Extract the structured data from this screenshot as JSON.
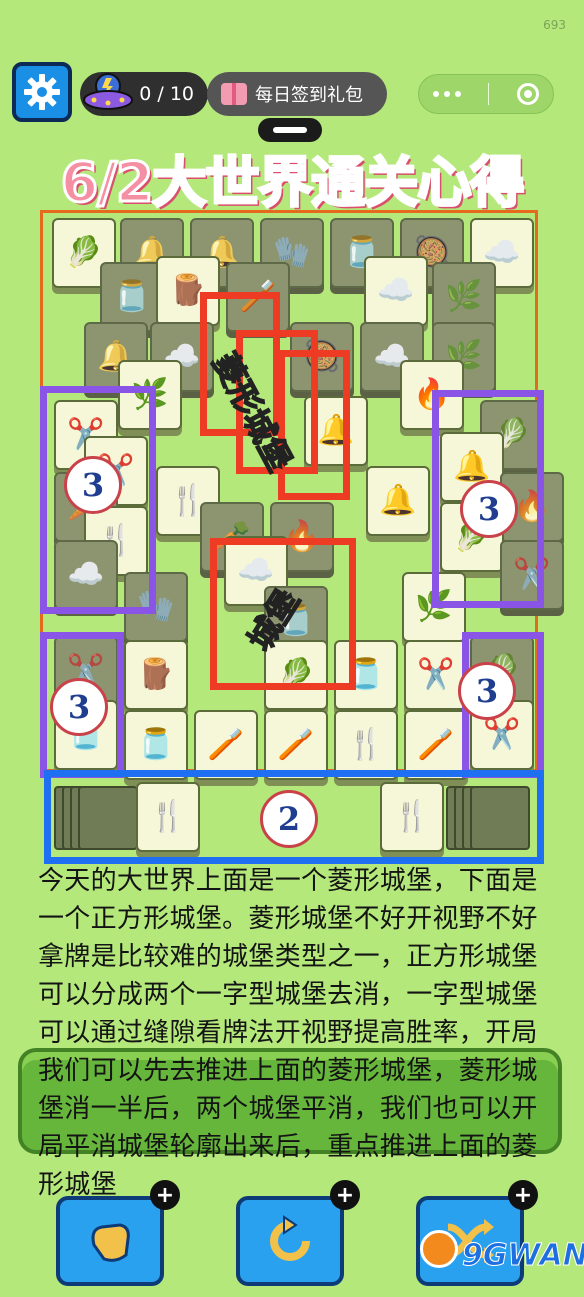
{
  "header": {
    "counter": "0 / 10",
    "daily_gift_label": "每日签到礼包",
    "corner_number": "693",
    "icons": [
      "gear-icon",
      "ufo-icon",
      "gift-icon",
      "more-dots-icon",
      "target-icon"
    ]
  },
  "title": "6/2大世界通关心得",
  "board": {
    "labels": {
      "diamond_castle": "菱形城堡",
      "castle": "城堡"
    },
    "badges": [
      "3",
      "3",
      "3",
      "3",
      "2"
    ],
    "tile_types": [
      "cabbage",
      "bell",
      "glove",
      "jar",
      "pot",
      "cotton",
      "grass",
      "stump",
      "fire",
      "shears",
      "rake",
      "brush",
      "carrot"
    ],
    "colors": {
      "red_box": "#ee3b24",
      "purple_box": "#8a55e6",
      "blue_box": "#1f6ff2"
    }
  },
  "strategy_text": "今天的大世界上面是一个菱形城堡，下面是一个正方形城堡。菱形城堡不好开视野不好拿牌是比较难的城堡类型之一，正方形城堡可以分成两个一字型城堡去消，一字型城堡可以通过缝隙看牌法开视野提高胜率，开局我们可以先去推进上面的菱形城堡，菱形城堡消一半后，两个城堡平消，我们也可以开局平消城堡轮廓出来后，重点推进上面的菱形城堡",
  "tools": [
    {
      "name": "remove-tool",
      "icon": "hand-icon"
    },
    {
      "name": "undo-tool",
      "icon": "undo-icon"
    },
    {
      "name": "shuffle-tool",
      "icon": "shuffle-icon"
    }
  ],
  "watermark": "9GWAN"
}
